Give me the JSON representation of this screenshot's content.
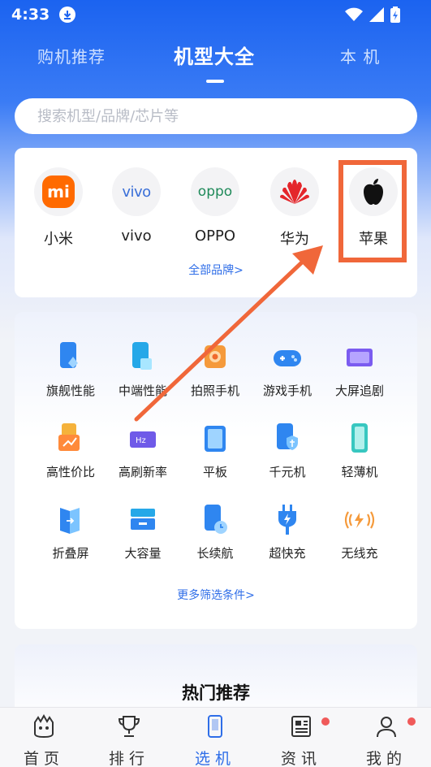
{
  "status": {
    "time": "4:33"
  },
  "tabs": [
    {
      "label": "购机推荐"
    },
    {
      "label": "机型大全"
    },
    {
      "label": "本 机"
    }
  ],
  "search": {
    "placeholder": "搜索机型/品牌/芯片等"
  },
  "brands": {
    "items": [
      {
        "label": "小米"
      },
      {
        "label": "vivo"
      },
      {
        "label": "OPPO"
      },
      {
        "label": "华为"
      },
      {
        "label": "苹果"
      }
    ],
    "more": "全部品牌>"
  },
  "filters": {
    "items": [
      {
        "label": "旗舰性能"
      },
      {
        "label": "中端性能"
      },
      {
        "label": "拍照手机"
      },
      {
        "label": "游戏手机"
      },
      {
        "label": "大屏追剧"
      },
      {
        "label": "高性价比"
      },
      {
        "label": "高刷新率"
      },
      {
        "label": "平板"
      },
      {
        "label": "千元机"
      },
      {
        "label": "轻薄机"
      },
      {
        "label": "折叠屏"
      },
      {
        "label": "大容量"
      },
      {
        "label": "长续航"
      },
      {
        "label": "超快充"
      },
      {
        "label": "无线充"
      }
    ],
    "more": "更多筛选条件>"
  },
  "hot": {
    "title": "热门推荐"
  },
  "logos": {
    "xiaomi": "mi",
    "vivo": "vivo",
    "oppo": "oppo",
    "hz": "Hz"
  },
  "nav": {
    "items": [
      {
        "label": "首页"
      },
      {
        "label": "排行"
      },
      {
        "label": "选机"
      },
      {
        "label": "资讯"
      },
      {
        "label": "我的"
      }
    ]
  },
  "colors": {
    "accent": "#2f6ee8",
    "highlight": "#f0673a",
    "brand_blue": "#1b63f0"
  }
}
